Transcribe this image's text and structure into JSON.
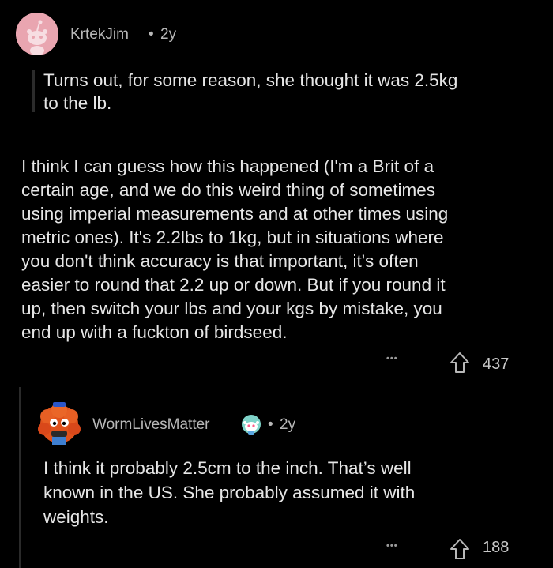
{
  "comment1": {
    "username": "KrtekJim",
    "separator": "•",
    "age": "2y",
    "quote_lines": [
      "Turns out, for some reason, she thought it was 2.5kg",
      "to the lb."
    ],
    "body_lines": [
      "I think I can guess how this happened (I'm a Brit of a",
      "certain age, and we do this weird thing of sometimes",
      "using imperial measurements and at other times using",
      "metric ones). It's 2.2lbs to 1kg, but in situations where",
      "you don't think accuracy is that important, it's often",
      "easier to round that 2.2 up or down. But if you round it",
      "up, then switch your lbs and your kgs by mistake, you",
      "end up with a fuckton of birdseed."
    ],
    "more_label": "•••",
    "score": "437",
    "avatar_icon": "snoo-avatar-icon",
    "avatar_bg": "#e9a5b0"
  },
  "comment2": {
    "username": "WormLivesMatter",
    "separator": "•",
    "age": "2y",
    "body_lines": [
      "I think it probably 2.5cm to the inch. That’s well",
      "known in the US. She probably assumed it with",
      "weights."
    ],
    "more_label": "•••",
    "score": "188",
    "avatar_icon": "orange-furry-avatar-icon",
    "badge_icon": "snoo-badge-icon"
  },
  "colors": {
    "background": "#000000",
    "text": "#e6e6e6",
    "meta": "#b8b8b8"
  }
}
